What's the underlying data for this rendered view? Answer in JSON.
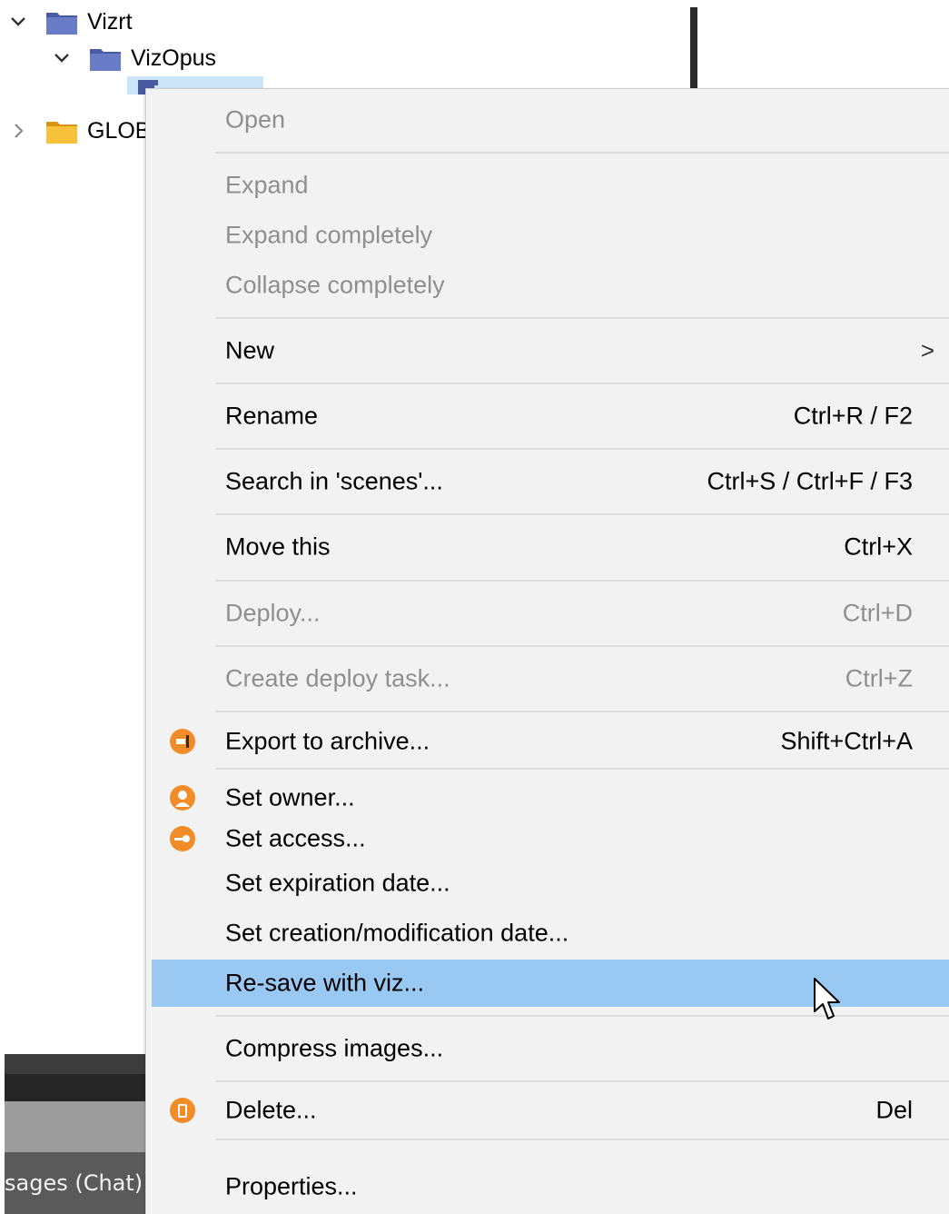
{
  "tree": {
    "items": [
      {
        "label": "Vizrt",
        "chevron": "chevron-down-icon",
        "folder_color": "#5b6bb0"
      },
      {
        "label": "VizOpus",
        "chevron": "chevron-down-icon",
        "folder_color": "#5b6bb0"
      },
      {
        "label": "GLOB",
        "chevron": "chevron-right-icon",
        "folder_color": "#f1b52b"
      }
    ]
  },
  "bottom_panel": {
    "tab_label": "sages (Chat)"
  },
  "context_menu": {
    "items": [
      {
        "label": "Open",
        "shortcut": "",
        "disabled": true
      },
      {
        "label": "Expand",
        "shortcut": "",
        "disabled": true
      },
      {
        "label": "Expand completely",
        "shortcut": "",
        "disabled": true
      },
      {
        "label": "Collapse completely",
        "shortcut": "",
        "disabled": true
      },
      {
        "label": "New",
        "shortcut": "",
        "disabled": false,
        "submenu_arrow": ">"
      },
      {
        "label": "Rename",
        "shortcut": "Ctrl+R / F2",
        "disabled": false
      },
      {
        "label": "Search in 'scenes'...",
        "shortcut": "Ctrl+S / Ctrl+F / F3",
        "disabled": false
      },
      {
        "label": "Move this",
        "shortcut": "Ctrl+X",
        "disabled": false
      },
      {
        "label": "Deploy...",
        "shortcut": "Ctrl+D",
        "disabled": true
      },
      {
        "label": "Create deploy task...",
        "shortcut": "Ctrl+Z",
        "disabled": true
      },
      {
        "label": "Export to archive...",
        "shortcut": "Shift+Ctrl+A",
        "disabled": false,
        "icon": "export-icon"
      },
      {
        "label": "Set owner...",
        "shortcut": "",
        "disabled": false,
        "icon": "owner-icon"
      },
      {
        "label": "Set access...",
        "shortcut": "",
        "disabled": false,
        "icon": "access-key-icon"
      },
      {
        "label": "Set expiration date...",
        "shortcut": "",
        "disabled": false
      },
      {
        "label": "Set creation/modification date...",
        "shortcut": "",
        "disabled": false
      },
      {
        "label": "Re-save with viz...",
        "shortcut": "",
        "disabled": false,
        "highlighted": true
      },
      {
        "label": "Compress images...",
        "shortcut": "",
        "disabled": false
      },
      {
        "label": "Delete...",
        "shortcut": "Del",
        "disabled": false,
        "icon": "delete-icon"
      },
      {
        "label": "Properties...",
        "shortcut": "",
        "disabled": false
      }
    ]
  },
  "colors": {
    "menu_bg": "#f2f2f2",
    "highlight": "#99c9f2",
    "disabled_text": "#8f8f8f",
    "icon_orange": "#f28c28"
  }
}
